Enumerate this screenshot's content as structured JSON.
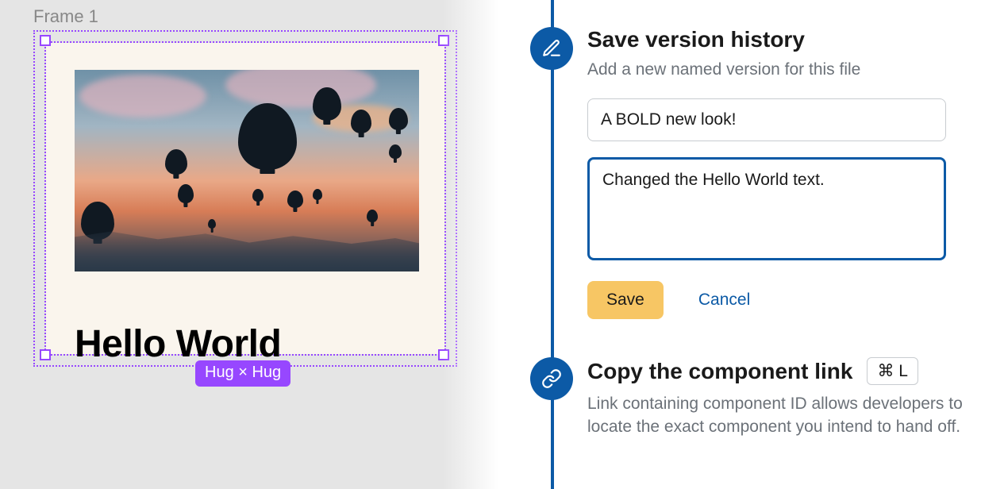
{
  "canvas": {
    "frame_label": "Frame 1",
    "card_heading": "Hello World",
    "constraint_badge": "Hug × Hug"
  },
  "tutorial": {
    "step1": {
      "title": "Save version history",
      "subtitle": "Add a new named version for this file",
      "version_title_value": "A BOLD new look!",
      "version_desc_value": "Changed the Hello World text.",
      "save_label": "Save",
      "cancel_label": "Cancel"
    },
    "step2": {
      "title": "Copy the component link",
      "shortcut": "⌘ L",
      "subtitle": "Link containing component ID allows developers to locate the exact component you intend to hand off."
    }
  }
}
